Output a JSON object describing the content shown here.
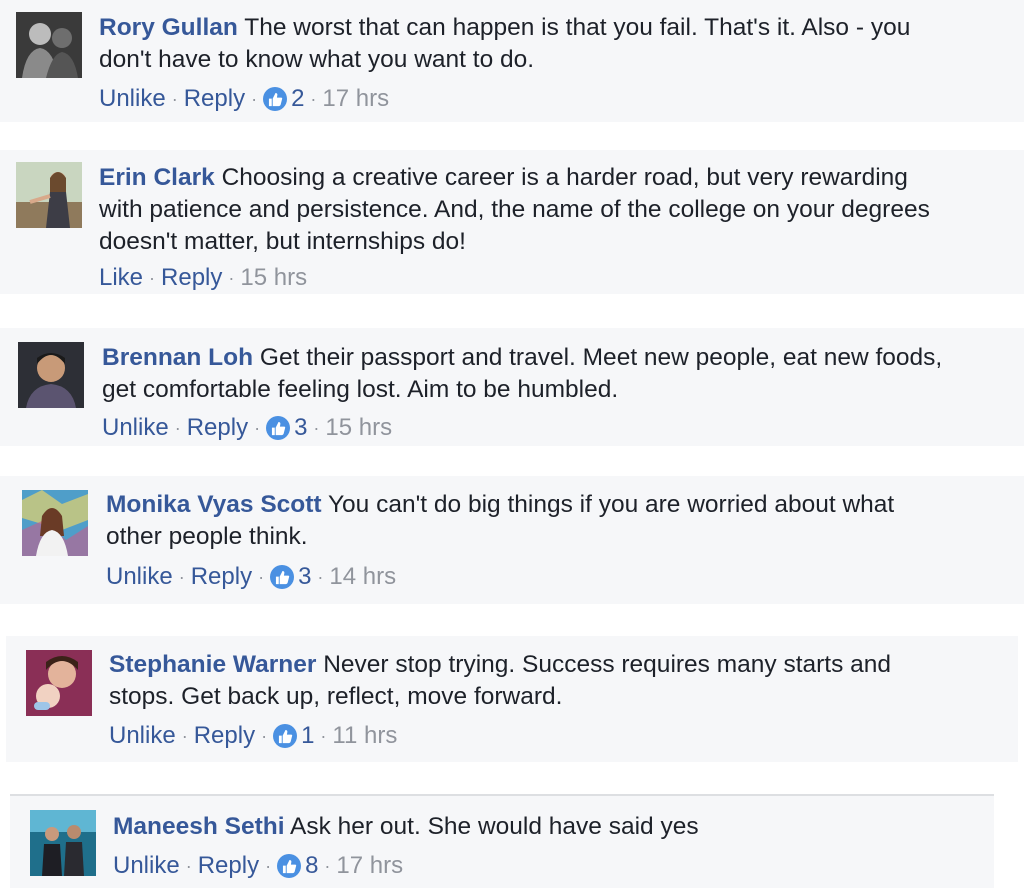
{
  "comments": [
    {
      "author": "Rory Gullan",
      "text": "The worst that can happen is that you fail. That's it. Also - you\ndon't have to know what you want to do.",
      "like_action": "Unlike",
      "reply_action": "Reply",
      "like_count": "2",
      "time": "17 hrs",
      "avatar_icon": "person-photo-dark"
    },
    {
      "author": "Erin Clark",
      "text": "Choosing a creative career is a harder road, but very rewarding\nwith patience and persistence. And, the name of the college on your degrees\ndoesn't matter, but internships do!",
      "like_action": "Like",
      "reply_action": "Reply",
      "like_count": "",
      "time": "15 hrs",
      "avatar_icon": "person-photo-outdoor"
    },
    {
      "author": "Brennan Loh",
      "text": "Get their passport and travel. Meet new people, eat new foods,\nget comfortable feeling lost. Aim to be humbled.",
      "like_action": "Unlike",
      "reply_action": "Reply",
      "like_count": "3",
      "time": "15 hrs",
      "avatar_icon": "person-photo-portrait"
    },
    {
      "author": "Monika Vyas Scott",
      "text": "You can't do big things if you are worried about what\nother people think.",
      "like_action": "Unlike",
      "reply_action": "Reply",
      "like_count": "3",
      "time": "14 hrs",
      "avatar_icon": "person-photo-mural"
    },
    {
      "author": "Stephanie Warner",
      "text": "Never stop trying. Success requires many starts and\nstops. Get back up, reflect, move forward.",
      "like_action": "Unlike",
      "reply_action": "Reply",
      "like_count": "1",
      "time": "11 hrs",
      "avatar_icon": "person-photo-baby"
    },
    {
      "author": "Maneesh Sethi",
      "text": "Ask her out. She would have said yes",
      "like_action": "Unlike",
      "reply_action": "Reply",
      "like_count": "8",
      "time": "17 hrs",
      "avatar_icon": "person-photo-stage"
    }
  ],
  "colors": {
    "author_link": "#365899",
    "action_link": "#365899",
    "meta_text": "#90949c",
    "body_text": "#1d2129",
    "comment_bg": "#f6f7f9",
    "like_badge": "#4a90e2"
  }
}
